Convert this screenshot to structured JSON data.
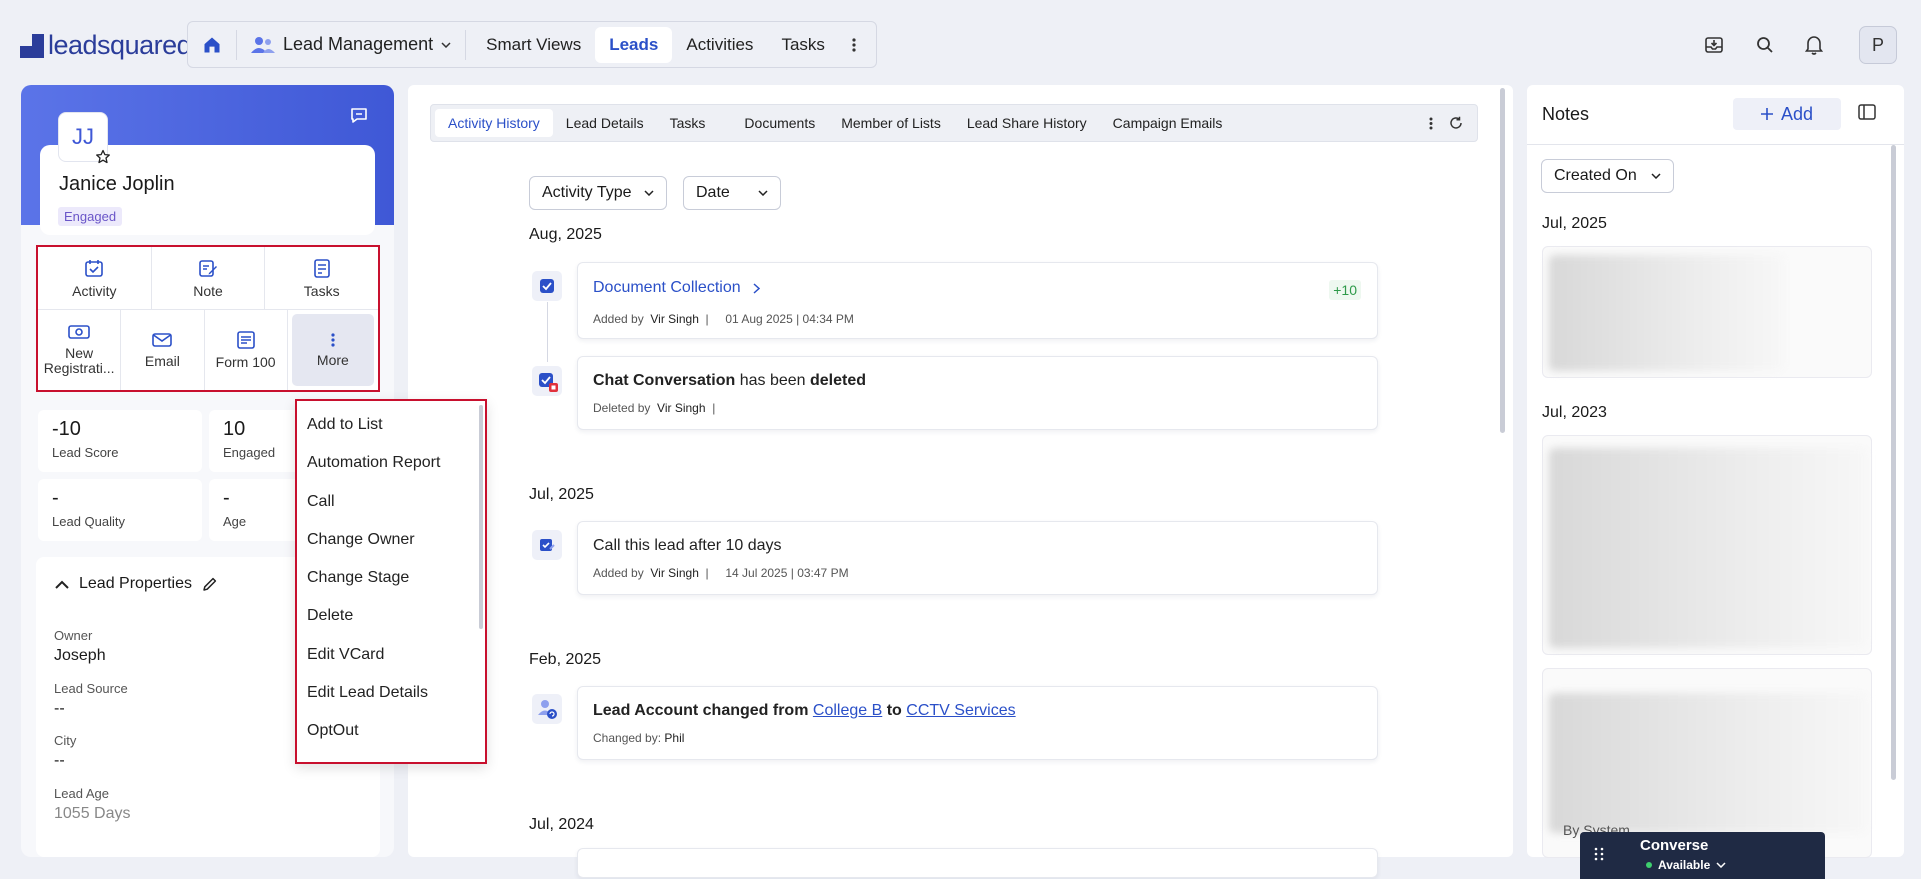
{
  "topbar": {
    "logo_text": "leadsquared",
    "module": "Lead Management",
    "tabs": [
      "Smart Views",
      "Leads",
      "Activities",
      "Tasks"
    ],
    "active_tab": "Leads",
    "user_initial": "P"
  },
  "lead": {
    "initials": "JJ",
    "name": "Janice Joplin",
    "stage": "Engaged"
  },
  "quick_actions": {
    "row1": [
      "Activity",
      "Note",
      "Tasks"
    ],
    "row2": [
      "New Registrati...",
      "Email",
      "Form 100",
      "More"
    ]
  },
  "stats": [
    {
      "value": "-10",
      "label": "Lead Score"
    },
    {
      "value": "10",
      "label": "Engaged"
    },
    {
      "value": "-",
      "label": "Lead Quality"
    },
    {
      "value": "-",
      "label": "Age"
    }
  ],
  "properties": {
    "title": "Lead Properties",
    "items": [
      {
        "label": "Owner",
        "value": "Joseph"
      },
      {
        "label": "Lead Source",
        "value": "--"
      },
      {
        "label": "City",
        "value": "--"
      },
      {
        "label": "Lead Age",
        "value": "1055 Days"
      }
    ]
  },
  "more_menu": [
    "Add to List",
    "Automation Report",
    "Call",
    "Change Owner",
    "Change Stage",
    "Delete",
    "Edit VCard",
    "Edit Lead Details",
    "OptOut"
  ],
  "detail_tabs": [
    "Activity History",
    "Lead Details",
    "Tasks",
    "Documents",
    "Member of Lists",
    "Lead Share History",
    "Campaign Emails"
  ],
  "filters": {
    "activity_type": "Activity Type",
    "date": "Date"
  },
  "timeline": {
    "m1": "Aug, 2025",
    "a1": {
      "title": "Document Collection",
      "score": "+10",
      "by_label": "Added by",
      "by": "Vir Singh",
      "date": "01 Aug 2025",
      "time": "04:34 PM"
    },
    "a2": {
      "title": "Chat Conversation",
      "mid": "has been",
      "end": "deleted",
      "by_label": "Deleted by",
      "by": "Vir Singh"
    },
    "m2": "Jul, 2025",
    "a3": {
      "title": "Call this lead after 10 days",
      "by_label": "Added by",
      "by": "Vir Singh",
      "date": "14 Jul 2025",
      "time": "03:47 PM"
    },
    "m3": "Feb, 2025",
    "a4": {
      "prefix": "Lead Account changed from",
      "from": "College B",
      "to_word": "to",
      "to": "CCTV Services",
      "by_label": "Changed by:",
      "by": "Phil"
    },
    "m4": "Jul, 2024"
  },
  "notes": {
    "title": "Notes",
    "add_label": "Add",
    "sort": "Created On",
    "m1": "Jul, 2025",
    "m2": "Jul, 2023",
    "by_system": "By System"
  },
  "converse": {
    "title": "Converse",
    "status": "Available",
    "status_color": "#3ecf6e"
  },
  "colors": {
    "brand": "#2b3d9a",
    "accent": "#2b50c8",
    "highlight": "#c8102e"
  }
}
